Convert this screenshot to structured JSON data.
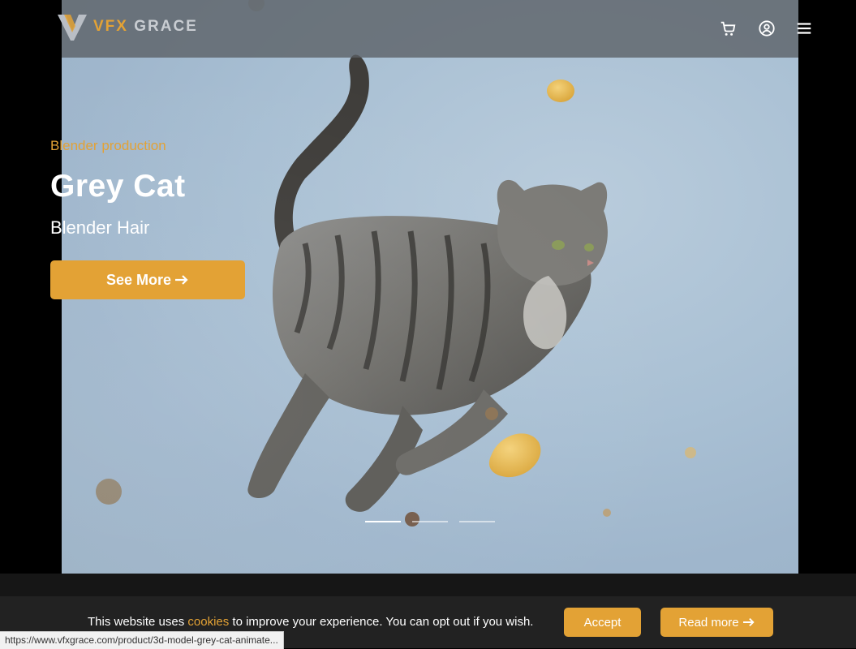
{
  "brand": {
    "logo_text_a": "VFX",
    "logo_text_b": " GRACE",
    "accent": "#e3a235"
  },
  "header": {
    "icons": [
      "cart-icon",
      "account-icon",
      "menu-icon"
    ]
  },
  "slide": {
    "eyebrow": "Blender production",
    "title": "Grey Cat",
    "subtitle": "Blender Hair",
    "button_label": "See More",
    "dots_count": 3,
    "active_dot": 1
  },
  "cookie": {
    "text_before": "This website uses ",
    "link_text": "cookies",
    "text_after": " to improve your experience. You can opt out if you wish.",
    "accept_label": "Accept",
    "read_more_label": "Read more"
  },
  "status_bar": {
    "url": "https://www.vfxgrace.com/product/3d-model-grey-cat-animate..."
  }
}
